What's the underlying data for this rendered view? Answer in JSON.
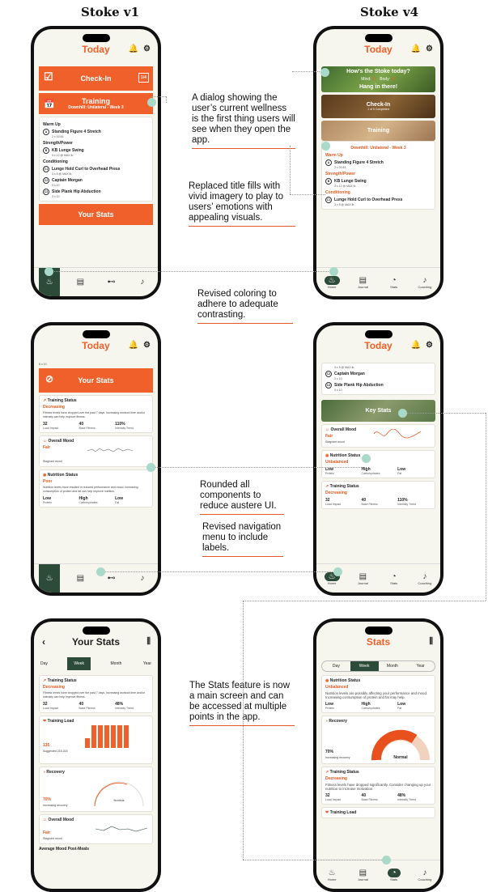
{
  "headers": {
    "v1": "Stoke v1",
    "v4": "Stoke v4"
  },
  "nav": {
    "home": "Home",
    "journal": "Journal",
    "stats": "Stats",
    "coaching": "Coaching"
  },
  "p1": {
    "title": "Today",
    "checkin": "Check-In",
    "checkin_count": "1/4",
    "training": "Training",
    "training_sub": "Downhill: Unilateral - Week 3",
    "warmup": "Warm Up",
    "ex_a": "Standing Figure 4 Stretch",
    "ex_a_s": "2 x 00:45",
    "strength": "Strength/Power",
    "ex_b": "KB Lunge Swing",
    "ex_b_s": "3 x 12 @ MAX lb.",
    "conditioning": "Conditioning",
    "ex_c1": "Lunge Hold Curl to Overhead Press",
    "ex_c1_s": "3 x 8 @ MAX lb.",
    "ex_c2": "Captain Morgan",
    "ex_c2_s": "3 x 10",
    "ex_c3": "Side Plank Hip Abduction",
    "ex_c3_s": "3 x 10",
    "your_stats": "Your Stats"
  },
  "p2": {
    "title": "Today",
    "checkin_q": "How's the Stoke today?",
    "mind": "Mind:",
    "body": "Body:",
    "hang": "Hang in there!",
    "checkin": "Check-In",
    "checkin_sub": "1 of 5 Completed",
    "training": "Training",
    "training_sub": "Downhill: Unilateral - Week 3",
    "warmup": "Warm Up",
    "ex_a": "Standing Figure 4 Stretch",
    "ex_a_s": "3 x 00:45",
    "strength": "Strength/Power",
    "ex_b": "KB Lunge Swing",
    "ex_b_s": "3 x 12 @ MAX lb.",
    "conditioning": "Conditioning",
    "ex_c1": "Lunge Hold Curl to Overhead Press",
    "ex_c1_s": "3 x 8 @ MAX lb."
  },
  "p3": {
    "title": "Today",
    "top": "8 x 10",
    "your_stats": "Your Stats",
    "ts": "Training Status",
    "ts_state": "Decreasing",
    "ts_text": "Fitness levels have dropped over the past 7 days. Increasing workout time and/or intensity can help improve fitness.",
    "v1": "32",
    "v1l": "Load Impact",
    "v2": "40",
    "v2l": "Base Fitness",
    "v3": "110%",
    "v3l": "Intensity Trend",
    "mood": "Overall Mood",
    "mood_state": "Fair",
    "mood_sub": "Stagnant mood",
    "nut": "Nutrition Status",
    "nut_state": "Poor",
    "nut_text": "Nutrition levels have resulted in reduced performance and mood. Increasing consumption of protein and fat can help improve nutrition.",
    "n1": "Low",
    "n1l": "Protein",
    "n2": "High",
    "n2l": "Carbohydrates",
    "n3": "Low",
    "n3l": "Fat"
  },
  "p4": {
    "title": "Today",
    "top": "3 x 8 @ MAX lb.",
    "ex_c2": "Captain Morgan",
    "ex_c2_s": "3 x 10",
    "ex_c3": "Side Plank Hip Abduction",
    "ex_c3_s": "3 x 10",
    "key_stats": "Key Stats",
    "mood": "Overall Mood",
    "mood_state": "Fair",
    "mood_sub": "Stagnant mood",
    "nut": "Nutrition Status",
    "nut_state": "Unbalanced",
    "n1": "Low",
    "n1l": "Protein",
    "n2": "High",
    "n2l": "Carbohydrates",
    "n3": "Low",
    "n3l": "Fat",
    "ts": "Training Status",
    "ts_state": "Decreasing",
    "v1": "32",
    "v1l": "Load Impact",
    "v2": "40",
    "v2l": "Base Fitness",
    "v3": "110%",
    "v3l": "Intensity Trend"
  },
  "p5": {
    "title": "Your Stats",
    "tabs": [
      "Day",
      "Week",
      "Month",
      "Year"
    ],
    "ts": "Training Status",
    "ts_state": "Decreasing",
    "ts_text": "Fitness levels have dropped over the past 7 days. Increasing workout time and/or intensity can help improve fitness.",
    "v1": "32",
    "v1l": "Load Impact",
    "v2": "40",
    "v2l": "Base Fitness",
    "v3": "48%",
    "v3l": "Intensity Trend",
    "tl": "Training Load",
    "tl_val": "135",
    "tl_sub": "Suggested 215-315",
    "rec": "Recovery",
    "rec_val": "70%",
    "rec_sub": "Increasing recovery",
    "rec_state": "Normal",
    "mood": "Overall Mood",
    "mood_state": "Fair",
    "mood_sub": "Stagnant mood",
    "last": "Average Mood Post-Meals"
  },
  "p6": {
    "title": "Stats",
    "tabs": [
      "Day",
      "Week",
      "Month",
      "Year"
    ],
    "nut": "Nutrition Status",
    "nut_state": "Unbalanced",
    "nut_text": "Nutrition levels are possibly affecting your performance and mood. Increasing consumption of protein and fat may help.",
    "n1": "Low",
    "n1l": "Protein",
    "n2": "High",
    "n2l": "Carbohydrates",
    "n3": "Low",
    "n3l": "Fat",
    "rec": "Recovery",
    "rec_val": "70%",
    "rec_sub": "Increasing recovery",
    "rec_state": "Normal",
    "ts": "Training Status",
    "ts_state": "Decreasing",
    "ts_text": "Fitness levels have dropped significantly. Consider changing up your nutrition to increase motivation.",
    "v1": "32",
    "v1l": "Load Impact",
    "v2": "40",
    "v2l": "Base Fitness",
    "v3": "48%",
    "v3l": "Intensity Trend",
    "tl": "Training Load"
  },
  "annotations": {
    "a1": "A dialog showing the user’s current wellness is the first thing users will see when they open the app.",
    "a2": "Replaced title fills with vivid imagery to play to users’ emotions with appealing visuals.",
    "a3": "Revised coloring to adhere to adequate contrasting.",
    "a4": "Rounded all components to reduce austere UI.",
    "a5": "Revised navigation menu to include labels.",
    "a6": "The Stats feature is now a main screen and can be accessed at multiple points in the app."
  },
  "colors": {
    "accent": "#f0602a",
    "nav_active": "#2d4b39",
    "callout_dot": "#a8d9c9"
  }
}
